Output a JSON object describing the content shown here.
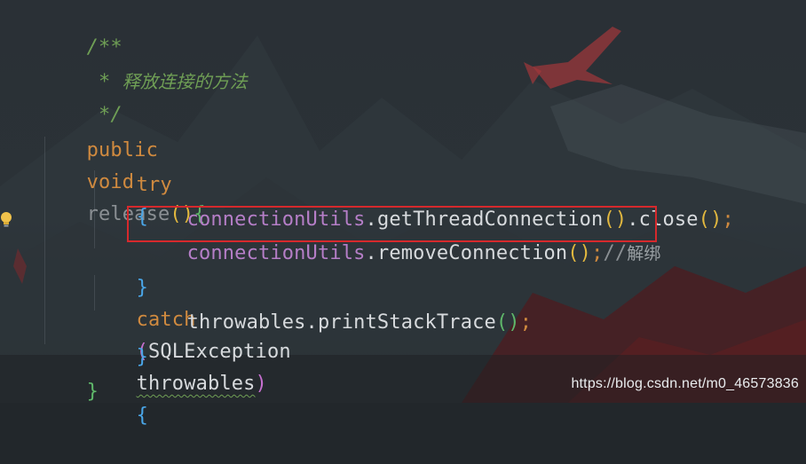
{
  "code": {
    "comment_open": "/**",
    "comment_star": " * ",
    "comment_text": "释放连接的方法",
    "comment_close": " */",
    "sig": {
      "public": "public",
      "void": "void",
      "name": "release",
      "lparen": "(",
      "rparen": ")",
      "lbrace": "{"
    },
    "try_kw": "try",
    "try_brace": "{",
    "line1": {
      "obj": "connectionUtils",
      "dot1": ".",
      "method": "getThreadConnection",
      "p1": "(",
      "p2": ")",
      "dot2": ".",
      "method2": "close",
      "p3": "(",
      "p4": ")",
      "semi": ";"
    },
    "line2": {
      "obj": "connectionUtils",
      "dot": ".",
      "method": "removeConnection",
      "p1": "(",
      "p2": ")",
      "semi": ";",
      "slashes": "//",
      "comment_zh": "解绑"
    },
    "catch_line": {
      "close_brace": "}",
      "catch_kw": "catch",
      "p1": "(",
      "type": "SQLException",
      "var": "throwables",
      "p2": ")",
      "open_brace": "{"
    },
    "line3": {
      "obj": "throwables",
      "dot": ".",
      "method": "printStackTrace",
      "p1": "(",
      "p2": ")",
      "semi": ";"
    },
    "inner_close": "}",
    "outer_close": "}"
  },
  "watermark": "https://blog.csdn.net/m0_46573836",
  "icons": {
    "bulb": "lightbulb-icon"
  },
  "colors": {
    "highlight_border": "#d6292c",
    "keyword": "#d08a3f",
    "comment": "#6f9f55",
    "field": "#b57ec7"
  }
}
